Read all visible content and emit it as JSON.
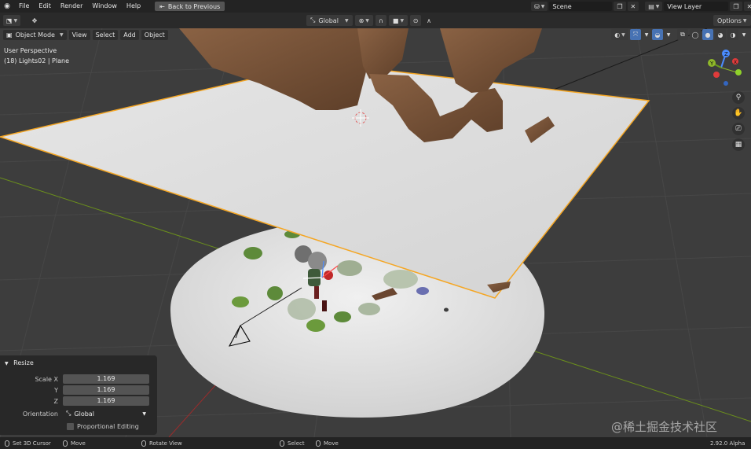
{
  "topbar": {
    "menus": [
      "File",
      "Edit",
      "Render",
      "Window",
      "Help"
    ],
    "back_button": "Back to Previous",
    "scene_name": "Scene",
    "view_layer": "View Layer"
  },
  "header": {
    "mode": "Object Mode",
    "menus": [
      "View",
      "Select",
      "Add",
      "Object"
    ],
    "transform_orientation": "Global",
    "options_label": "Options"
  },
  "viewport": {
    "view_name": "User Perspective",
    "object_info": "(18) Lights02 | Plane"
  },
  "redo_panel": {
    "title": "Resize",
    "scale_x_label": "Scale X",
    "scale_x": "1.169",
    "y_label": "Y",
    "scale_y": "1.169",
    "z_label": "Z",
    "scale_z": "1.169",
    "orientation_label": "Orientation",
    "orientation_value": "Global",
    "proportional_label": "Proportional Editing"
  },
  "statusbar": {
    "set_cursor": "Set 3D Cursor",
    "move1": "Move",
    "rotate": "Rotate View",
    "select": "Select",
    "move2": "Move",
    "version": "2.92.0 Alpha"
  },
  "watermark": "@稀土掘金技术社区",
  "colors": {
    "selected_outline": "#f5a623",
    "tree_brown": "#7a5438",
    "plane_white": "#dadada",
    "grid_bg": "#3d3d3d",
    "axis_x": "#9b2c2c",
    "axis_y": "#6b8f1c"
  }
}
